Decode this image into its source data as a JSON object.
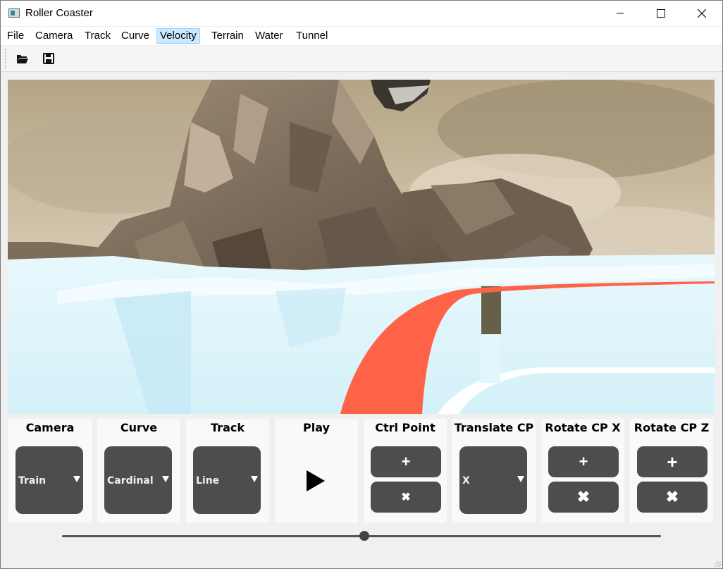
{
  "window": {
    "title": "Roller Coaster"
  },
  "menu": [
    "File",
    "Camera",
    "Track",
    "Curve",
    "Velocity",
    "Terrain",
    "Water",
    "Tunnel"
  ],
  "menu_active": "Velocity",
  "toolbar": {
    "open_icon": "folder-open-icon",
    "save_icon": "floppy-disk-icon"
  },
  "controls": {
    "camera": {
      "title": "Camera",
      "value": "Train"
    },
    "curve": {
      "title": "Curve",
      "value": "Cardinal"
    },
    "track": {
      "title": "Track",
      "value": "Line"
    },
    "play": {
      "title": "Play"
    },
    "ctrl_point": {
      "title": "Ctrl Point",
      "add": "+",
      "remove": "✖"
    },
    "translate_cp": {
      "title": "Translate CP",
      "value": "X"
    },
    "rotate_x": {
      "title": "Rotate CP X",
      "inc": "+",
      "dec": "✖"
    },
    "rotate_z": {
      "title": "Rotate CP Z",
      "inc": "+",
      "dec": "✖"
    }
  },
  "slider": {
    "value": 0.5
  },
  "colors": {
    "track": "#ff6347",
    "water": "#dff4fb",
    "rock": "#8a7a66",
    "button": "#4d4d4d"
  }
}
